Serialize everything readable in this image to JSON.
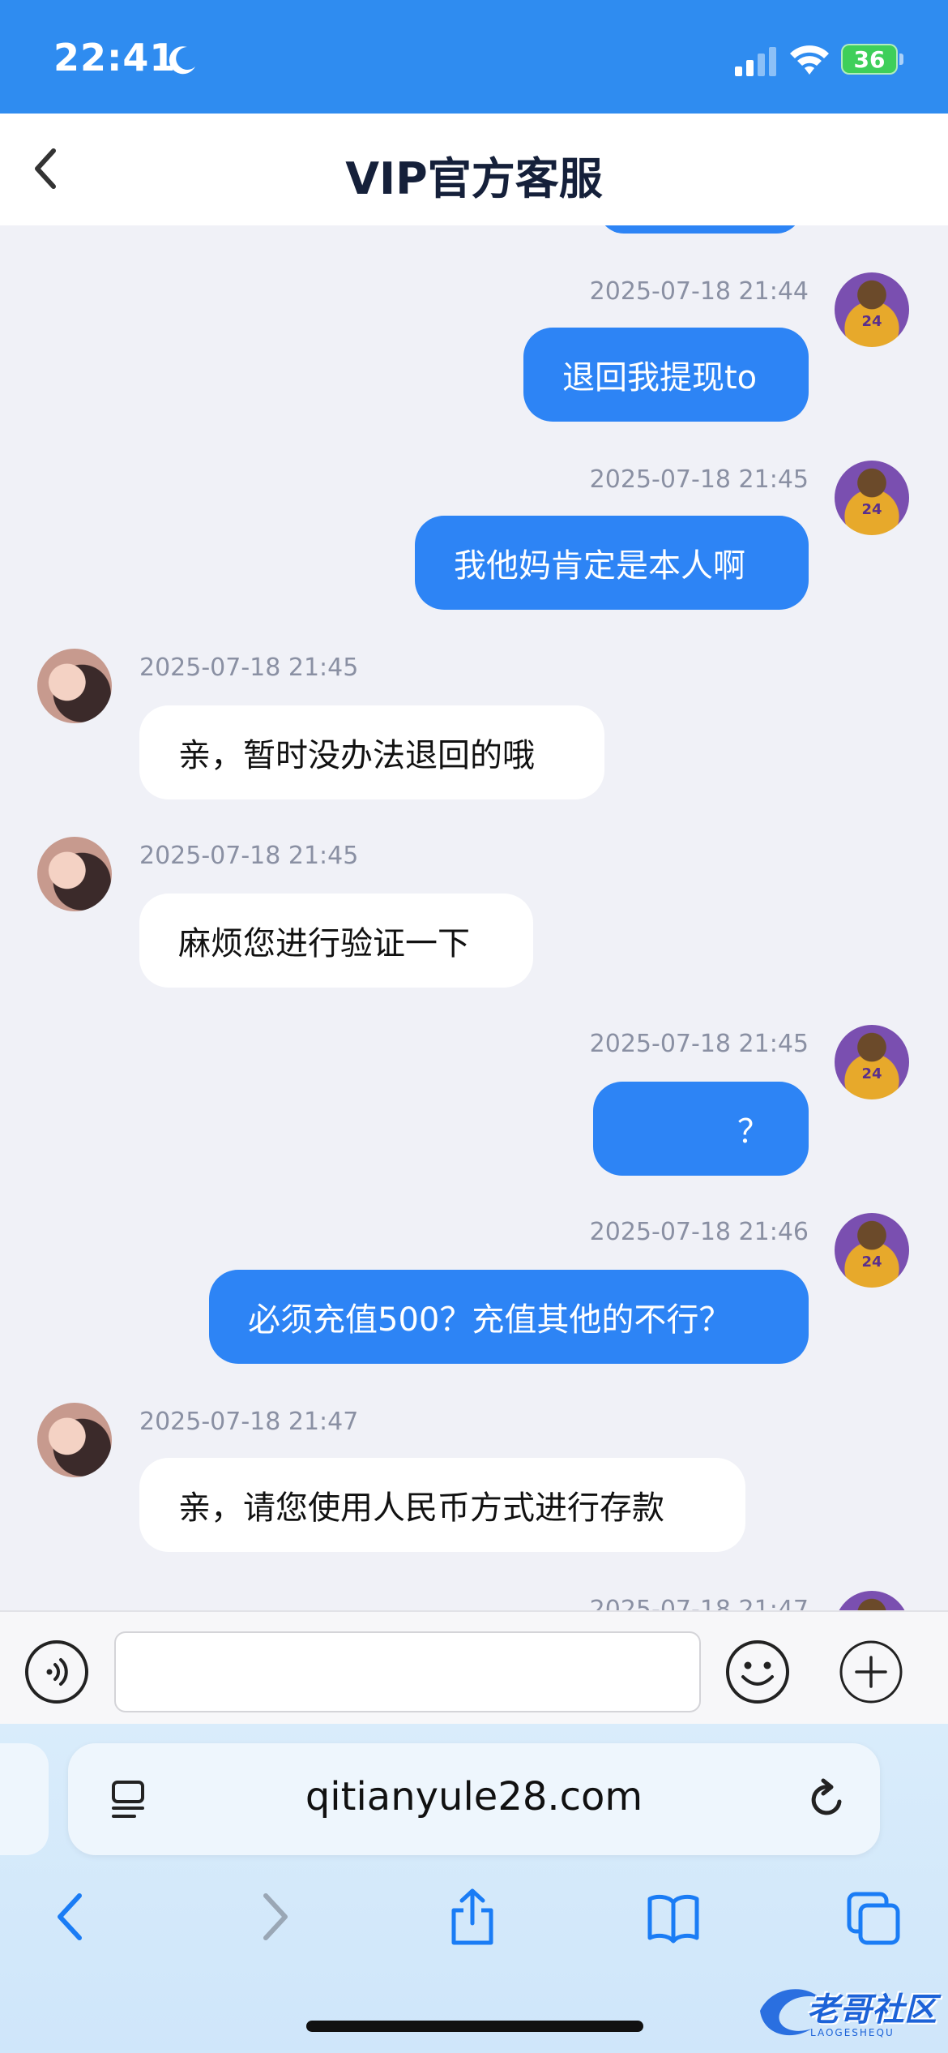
{
  "status_bar": {
    "time": "22:41",
    "battery": "36"
  },
  "header": {
    "title": "VIP官方客服"
  },
  "messages": [
    {
      "side": "user",
      "timestamp": "2025-07-18 21:44",
      "text": "退回我提现to"
    },
    {
      "side": "user",
      "timestamp": "2025-07-18 21:45",
      "text": "我他妈肯定是本人啊"
    },
    {
      "side": "agent",
      "timestamp": "2025-07-18 21:45",
      "text": "亲，暂时没办法退回的哦"
    },
    {
      "side": "agent",
      "timestamp": "2025-07-18 21:45",
      "text": "麻烦您进行验证一下"
    },
    {
      "side": "user",
      "timestamp": "2025-07-18 21:45",
      "text": "？"
    },
    {
      "side": "user",
      "timestamp": "2025-07-18 21:46",
      "text": "必须充值500？充值其他的不行？"
    },
    {
      "side": "agent",
      "timestamp": "2025-07-18 21:47",
      "text": "亲，请您使用人民币方式进行存款"
    },
    {
      "side": "user",
      "timestamp": "2025-07-18 21:47",
      "text": ""
    }
  ],
  "input": {
    "value": "",
    "placeholder": ""
  },
  "browser": {
    "url": "qitianyule28.com"
  },
  "watermark": {
    "title": "老哥社区",
    "subtitle": "LAOGESHEQU"
  },
  "colors": {
    "status_bar": "#2f8cf0",
    "user_bubble": "#2d84f5",
    "agent_bubble": "#ffffff",
    "chat_bg": "#f0f1f7"
  }
}
